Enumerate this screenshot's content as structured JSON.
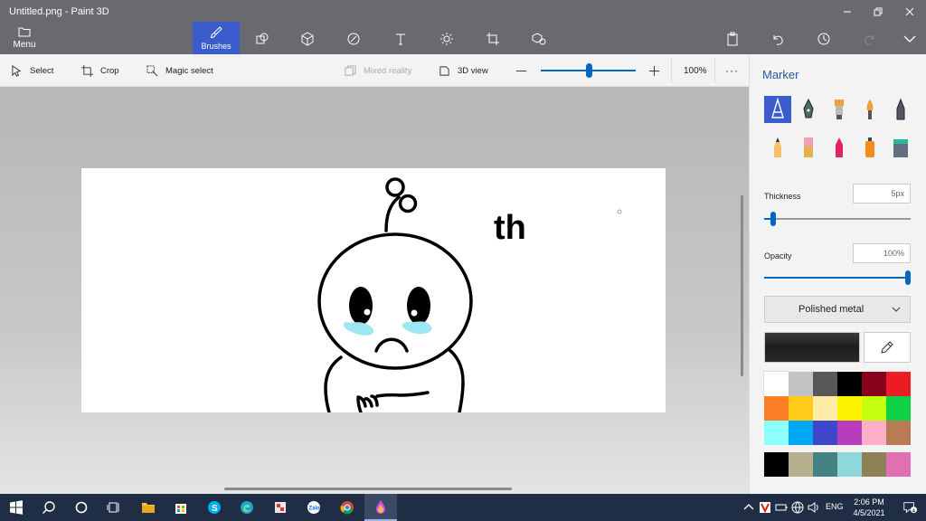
{
  "window": {
    "title": "Untitled.png - Paint 3D"
  },
  "ribbon": {
    "menu_label": "Menu",
    "brushes_label": "Brushes",
    "tools": [
      "shapes-2d-icon",
      "shapes-3d-icon",
      "stickers-icon",
      "text-icon",
      "effects-icon",
      "canvas-icon",
      "library-icon"
    ]
  },
  "toolbar": {
    "select_label": "Select",
    "crop_label": "Crop",
    "magic_select_label": "Magic select",
    "mixed_reality_label": "Mixed reality",
    "view_3d_label": "3D view",
    "zoom_value": "100%",
    "zoom_level": 0.5
  },
  "panel": {
    "title": "Marker",
    "thickness_label": "Thickness",
    "thickness_value": "5px",
    "thickness_level": 0.06,
    "opacity_label": "Opacity",
    "opacity_value": "100%",
    "opacity_level": 1.0,
    "material": "Polished metal",
    "palette": [
      "#ffffff",
      "#c3c3c3",
      "#585858",
      "#000000",
      "#88001b",
      "#ec1c24",
      "#ff7f27",
      "#ffca18",
      "#fdeca6",
      "#fff200",
      "#c4ff0e",
      "#0ed145",
      "#8cfffb",
      "#00a8f3",
      "#3f48cc",
      "#b83dba",
      "#ffaec8",
      "#b97a56"
    ],
    "custom_colors": [
      "#000000",
      "#b7b08e",
      "#468283",
      "#8ed8dc",
      "#8f8058",
      "#e070b0"
    ]
  },
  "canvas": {
    "text": "th"
  },
  "taskbar": {
    "language": "ENG",
    "time": "2:06 PM",
    "date": "4/5/2021",
    "notification_count": "4"
  }
}
